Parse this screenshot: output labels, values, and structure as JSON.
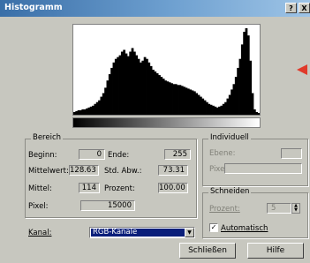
{
  "window": {
    "title": "Histogramm",
    "help_glyph": "?",
    "close_glyph": "X"
  },
  "histogram": {
    "bins": [
      3,
      4,
      5,
      5,
      6,
      6,
      7,
      8,
      9,
      10,
      12,
      14,
      16,
      20,
      24,
      30,
      38,
      45,
      52,
      58,
      62,
      64,
      66,
      70,
      72,
      68,
      65,
      70,
      74,
      70,
      66,
      62,
      58,
      60,
      64,
      62,
      58,
      54,
      50,
      48,
      46,
      44,
      42,
      40,
      38,
      37,
      36,
      35,
      34,
      34,
      33,
      33,
      32,
      31,
      30,
      29,
      28,
      27,
      26,
      24,
      22,
      20,
      18,
      16,
      14,
      12,
      11,
      10,
      9,
      8,
      9,
      10,
      12,
      14,
      18,
      22,
      28,
      34,
      42,
      52,
      62,
      78,
      92,
      96,
      88,
      60,
      24,
      6,
      3,
      2
    ],
    "max": 96
  },
  "bereich": {
    "title": "Bereich",
    "beginn_label": "Beginn:",
    "beginn_value": "0",
    "ende_label": "Ende:",
    "ende_value": "255",
    "mittelwert_label": "Mittelwert:",
    "mittelwert_value": "128.63",
    "std_label": "Std. Abw.:",
    "std_value": "73.31",
    "mittel_label": "Mittel:",
    "mittel_value": "114",
    "prozent_label": "Prozent:",
    "prozent_value": "100.00",
    "pixel_label": "Pixel:",
    "pixel_value": "15000"
  },
  "individuell": {
    "title": "Individuell",
    "ebene_label": "Ebene:",
    "pixel_label": "Pixel:"
  },
  "schneiden": {
    "title": "Schneiden",
    "prozent_label": "Prozent:",
    "prozent_value": "5",
    "auto_label": "Automatisch",
    "auto_checked": "✓"
  },
  "kanal": {
    "label": "Kanal:",
    "selected": "RGB-Kanäle"
  },
  "buttons": {
    "close": "Schließen",
    "help": "Hilfe"
  },
  "colors": {
    "accent": "#0a1e7a",
    "arrow": "#e03a2a"
  }
}
